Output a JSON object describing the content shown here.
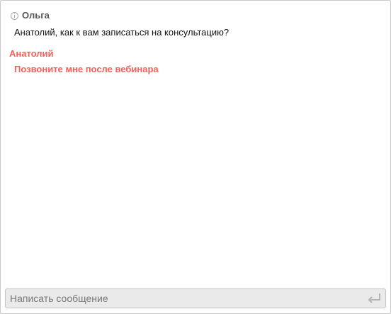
{
  "chat": {
    "messages": [
      {
        "author": "Ольга",
        "text": "Анатолий, как к вам записаться на консультацию?",
        "icon": "info-icon"
      },
      {
        "author": "Анатолий",
        "text": "Позвоните мне после вебинара"
      }
    ],
    "colors": {
      "incoming_author": "#555555",
      "outgoing_author": "#f2605a"
    }
  },
  "composer": {
    "placeholder": "Написать сообщение",
    "value": "",
    "send_icon": "enter-return-icon"
  }
}
